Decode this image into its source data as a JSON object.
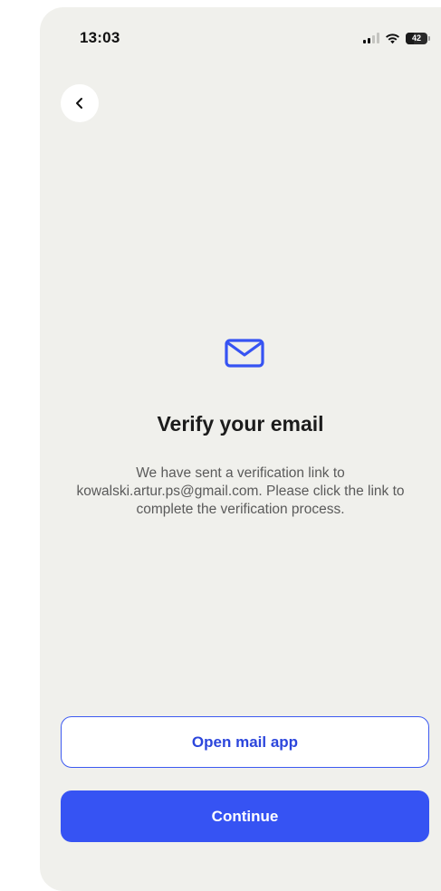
{
  "status_bar": {
    "time": "13:03",
    "battery": "42",
    "icons": [
      "signal-icon",
      "wifi-icon",
      "battery-icon"
    ]
  },
  "nav": {
    "back_icon": "chevron-left-icon"
  },
  "content": {
    "icon": "envelope-icon",
    "title": "Verify your email",
    "description": "We have sent a verification link to kowalski.artur.ps@gmail.com. Please click the link to complete the verification process."
  },
  "actions": {
    "open_mail_label": "Open mail app",
    "continue_label": "Continue"
  },
  "colors": {
    "background": "#f0f0ec",
    "accent": "#3653f3",
    "secondary_border": "#3d5af1"
  }
}
